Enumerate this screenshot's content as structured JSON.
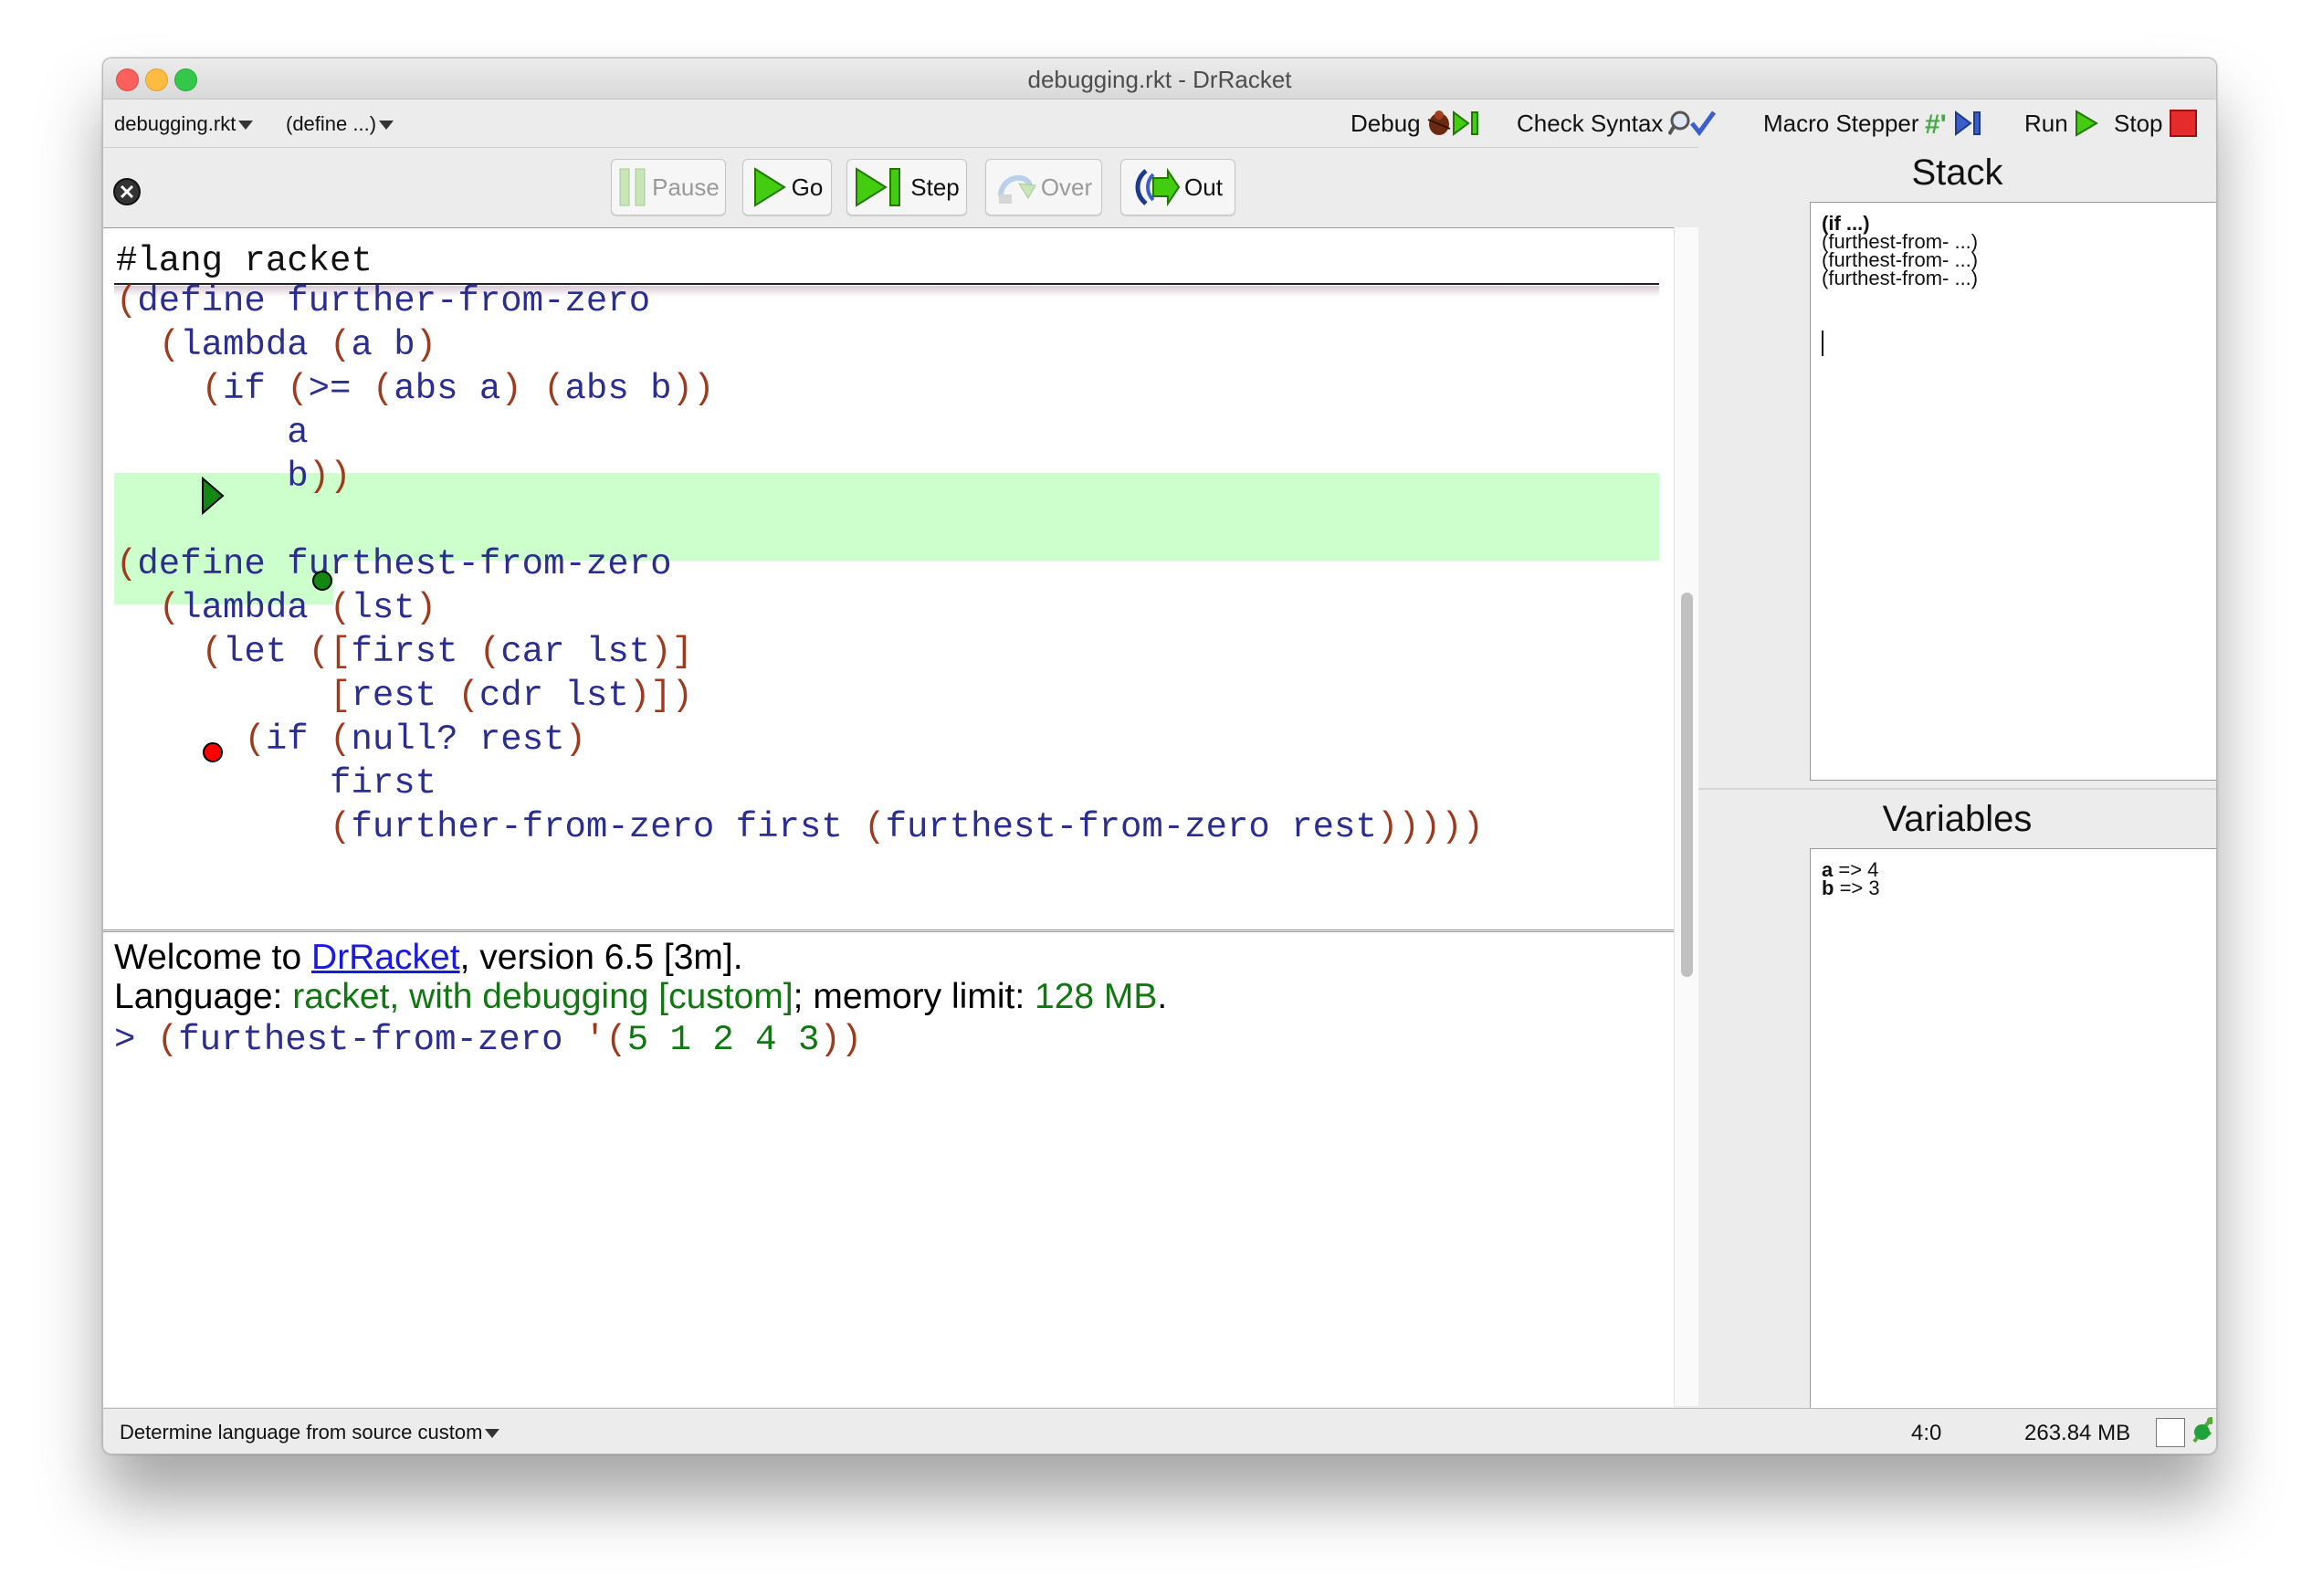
{
  "window": {
    "title": "debugging.rkt - DrRacket",
    "traffic_lights": {
      "close": "#fc605c",
      "minimize": "#fdbc40",
      "zoom": "#34c84a"
    }
  },
  "toolbar": {
    "file_menu": "debugging.rkt",
    "define_menu": "(define ...)",
    "debug_label": "Debug",
    "check_syntax_label": "Check Syntax",
    "macro_stepper_label": "Macro Stepper",
    "run_label": "Run",
    "stop_label": "Stop"
  },
  "debug_buttons": {
    "pause": "Pause",
    "go": "Go",
    "step": "Step",
    "over": "Over",
    "out": "Out"
  },
  "editor": {
    "lang_line": "#lang racket",
    "colors": {
      "paren": "#9e3a1e",
      "ident": "#2b2e8c",
      "highlight": "#ccffcc",
      "breakpoint": "#ff0000",
      "current": "#118811"
    },
    "lines": [
      {
        "indent": "",
        "paren": "(",
        "text": "define further-from-zero",
        "tail": ""
      },
      {
        "indent": "  ",
        "paren": "(",
        "text": "lambda (a b)",
        "tail": ""
      },
      {
        "indent": "    ",
        "paren": "(",
        "text": "if (>= (abs a) (abs b))",
        "tail": ""
      },
      {
        "indent": "        ",
        "paren": "",
        "text": "a",
        "tail": ""
      },
      {
        "indent": "        ",
        "paren": "",
        "text": "b",
        "tail": "))"
      },
      {
        "indent": "",
        "paren": "(",
        "text": "define furthest-from-zero",
        "tail": ""
      },
      {
        "indent": "  ",
        "paren": "(",
        "text": "lambda (lst)",
        "tail": ""
      },
      {
        "indent": "    ",
        "paren": "(",
        "text": "let ([first (car lst)]",
        "tail": ""
      },
      {
        "indent": "          ",
        "paren": "",
        "text": "[rest (cdr lst)])",
        "tail": ""
      },
      {
        "indent": "      ",
        "paren": "(",
        "text": "if (null? rest)",
        "tail": ""
      },
      {
        "indent": "          ",
        "paren": "",
        "text": "first",
        "tail": ""
      },
      {
        "indent": "          ",
        "paren": "",
        "text": "(further-from-zero first (furthest-from-zero rest)))))",
        "tail": ""
      }
    ]
  },
  "repl": {
    "welcome_prefix": "Welcome to ",
    "welcome_link": "DrRacket",
    "welcome_suffix": ", version 6.5 [3m].",
    "language_label": "Language: ",
    "language_value": "racket, with debugging [custom]",
    "memory_label": "; memory limit: ",
    "memory_value": "128 MB",
    "memory_end": ".",
    "prompt": ">",
    "input": "(furthest-from-zero '(5 1 2 4 3))"
  },
  "stack_panel": {
    "title": "Stack",
    "frames": [
      "(if ...)",
      "(furthest-from- ...)",
      "(furthest-from- ...)",
      "(furthest-from- ...)"
    ]
  },
  "variables_panel": {
    "title": "Variables",
    "vars": [
      {
        "name": "a",
        "value": "=> 4"
      },
      {
        "name": "b",
        "value": "=> 3"
      }
    ]
  },
  "status_bar": {
    "language": "Determine language from source custom",
    "position": "4:0",
    "memory": "263.84 MB"
  }
}
